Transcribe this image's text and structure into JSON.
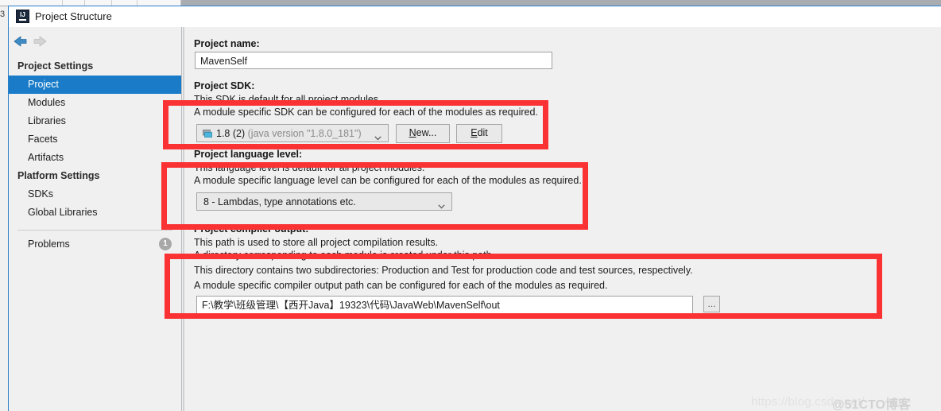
{
  "background": {
    "edge_char": "3"
  },
  "window": {
    "title": "Project Structure",
    "app_icon": "intellij-idea-icon",
    "icon_letters": "IJ"
  },
  "nav": {
    "back_icon": "arrow-left-icon",
    "forward_icon": "arrow-right-icon"
  },
  "sidebar": {
    "groups": [
      {
        "label": "Project Settings",
        "items": [
          {
            "label": "Project",
            "selected": true
          },
          {
            "label": "Modules",
            "selected": false
          },
          {
            "label": "Libraries",
            "selected": false
          },
          {
            "label": "Facets",
            "selected": false
          },
          {
            "label": "Artifacts",
            "selected": false
          }
        ]
      },
      {
        "label": "Platform Settings",
        "items": [
          {
            "label": "SDKs",
            "selected": false
          },
          {
            "label": "Global Libraries",
            "selected": false
          }
        ]
      }
    ],
    "problems": {
      "label": "Problems",
      "badge_count": "1"
    }
  },
  "main": {
    "project_name": {
      "label": "Project name:",
      "value": "MavenSelf"
    },
    "project_sdk": {
      "label": "Project SDK:",
      "desc1": "This SDK is default for all project modules.",
      "desc2": "A module specific SDK can be configured for each of the modules as required.",
      "combo_icon": "sdk-module-icon",
      "combo_value": "1.8 (2)",
      "combo_value_detail": "(java version \"1.8.0_181\")",
      "chevron_icon": "chevron-down-icon",
      "new_button": "New...",
      "new_button_mnemonic": "N",
      "new_button_rest": "ew...",
      "edit_button": "Edit",
      "edit_button_mnemonic": "E",
      "edit_button_rest": "dit"
    },
    "language_level": {
      "label": "Project language level:",
      "desc1": "This language level is default for all project modules.",
      "desc2": "A module specific language level can be configured for each of the modules as required.",
      "combo_value": "8 - Lambdas, type annotations etc.",
      "chevron_icon": "chevron-down-icon"
    },
    "compiler_output": {
      "label": "Project compiler output:",
      "desc1": "This path is used to store all project compilation results.",
      "desc2": "A directory corresponding to each module is created under this path.",
      "desc3": "This directory contains two subdirectories: Production and Test for production code and test sources, respectively.",
      "desc4": "A module specific compiler output path can be configured for each of the modules as required.",
      "value": "F:\\教学\\班级管理\\【西开Java】19323\\代码\\JavaWeb\\MavenSelf\\out",
      "browse_button": "...",
      "browse_icon": "ellipsis-browse-icon"
    }
  },
  "annotations": {
    "color": "#fb3233",
    "boxes": [
      {
        "name": "sdk-highlight"
      },
      {
        "name": "language-level-highlight"
      },
      {
        "name": "compiler-output-highlight"
      }
    ]
  },
  "watermark": {
    "url": "https://blog.csdn.net/",
    "brand": "@51CTO博客"
  }
}
